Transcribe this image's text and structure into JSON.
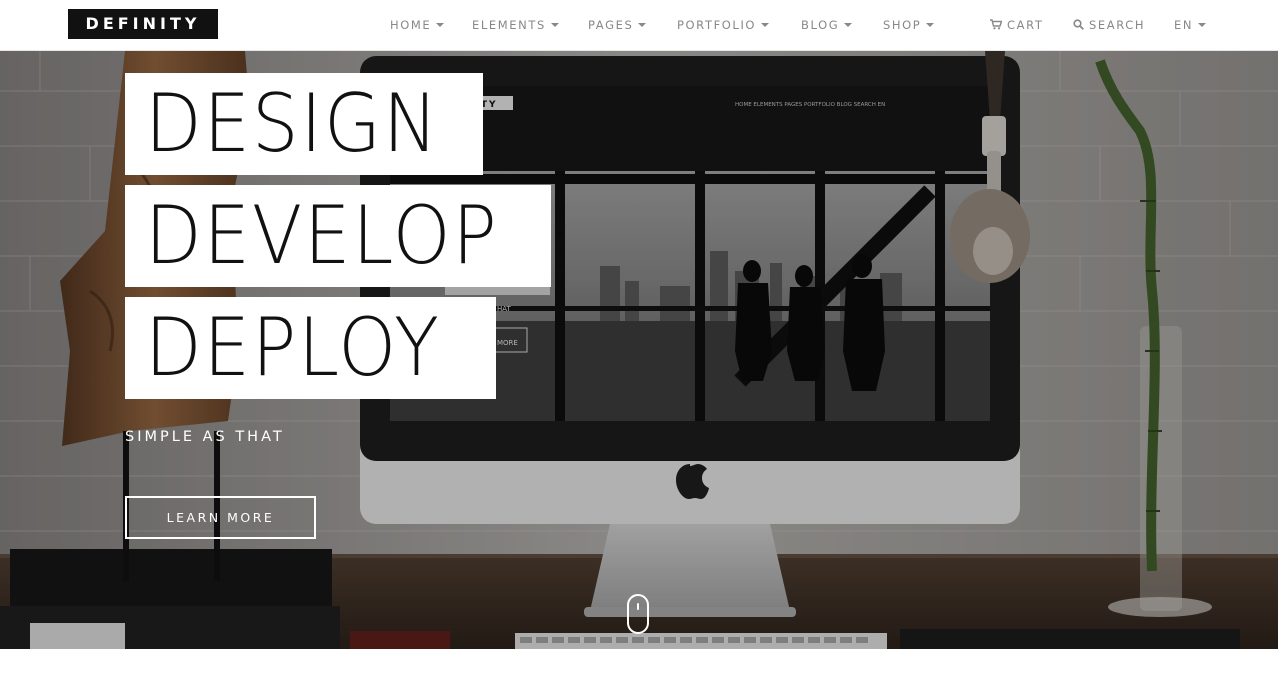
{
  "brand": {
    "logo_text": "DEFINITY"
  },
  "nav": {
    "items": [
      {
        "label": "HOME",
        "has_caret": true
      },
      {
        "label": "ELEMENTS",
        "has_caret": true
      },
      {
        "label": "PAGES",
        "has_caret": true
      },
      {
        "label": "PORTFOLIO",
        "has_caret": true
      },
      {
        "label": "BLOG",
        "has_caret": true
      },
      {
        "label": "SHOP",
        "has_caret": true
      }
    ],
    "cart_label": "CART",
    "cart_icon": "cart-icon",
    "search_label": "SEARCH",
    "search_icon": "search-icon",
    "language_label": "EN"
  },
  "hero": {
    "headlines": [
      "DESIGN",
      "DEVELOP",
      "DEPLOY"
    ],
    "tagline": "SIMPLE AS THAT",
    "cta_label": "LEARN MORE",
    "scroll_icon": "mouse-scroll-icon",
    "monitor_screen": {
      "logo_fragment": "NITY",
      "nav_text": "HOME   ELEMENTS   PAGES   PORTFOLIO   BLOG      SEARCH   EN",
      "fragment_1": "HAT",
      "fragment_2": "MORE"
    }
  },
  "colors": {
    "nav_text": "#888888",
    "logo_bg": "#111111",
    "headline_bg": "#ffffff",
    "headline_text": "#111111",
    "overlay": "#000000"
  }
}
